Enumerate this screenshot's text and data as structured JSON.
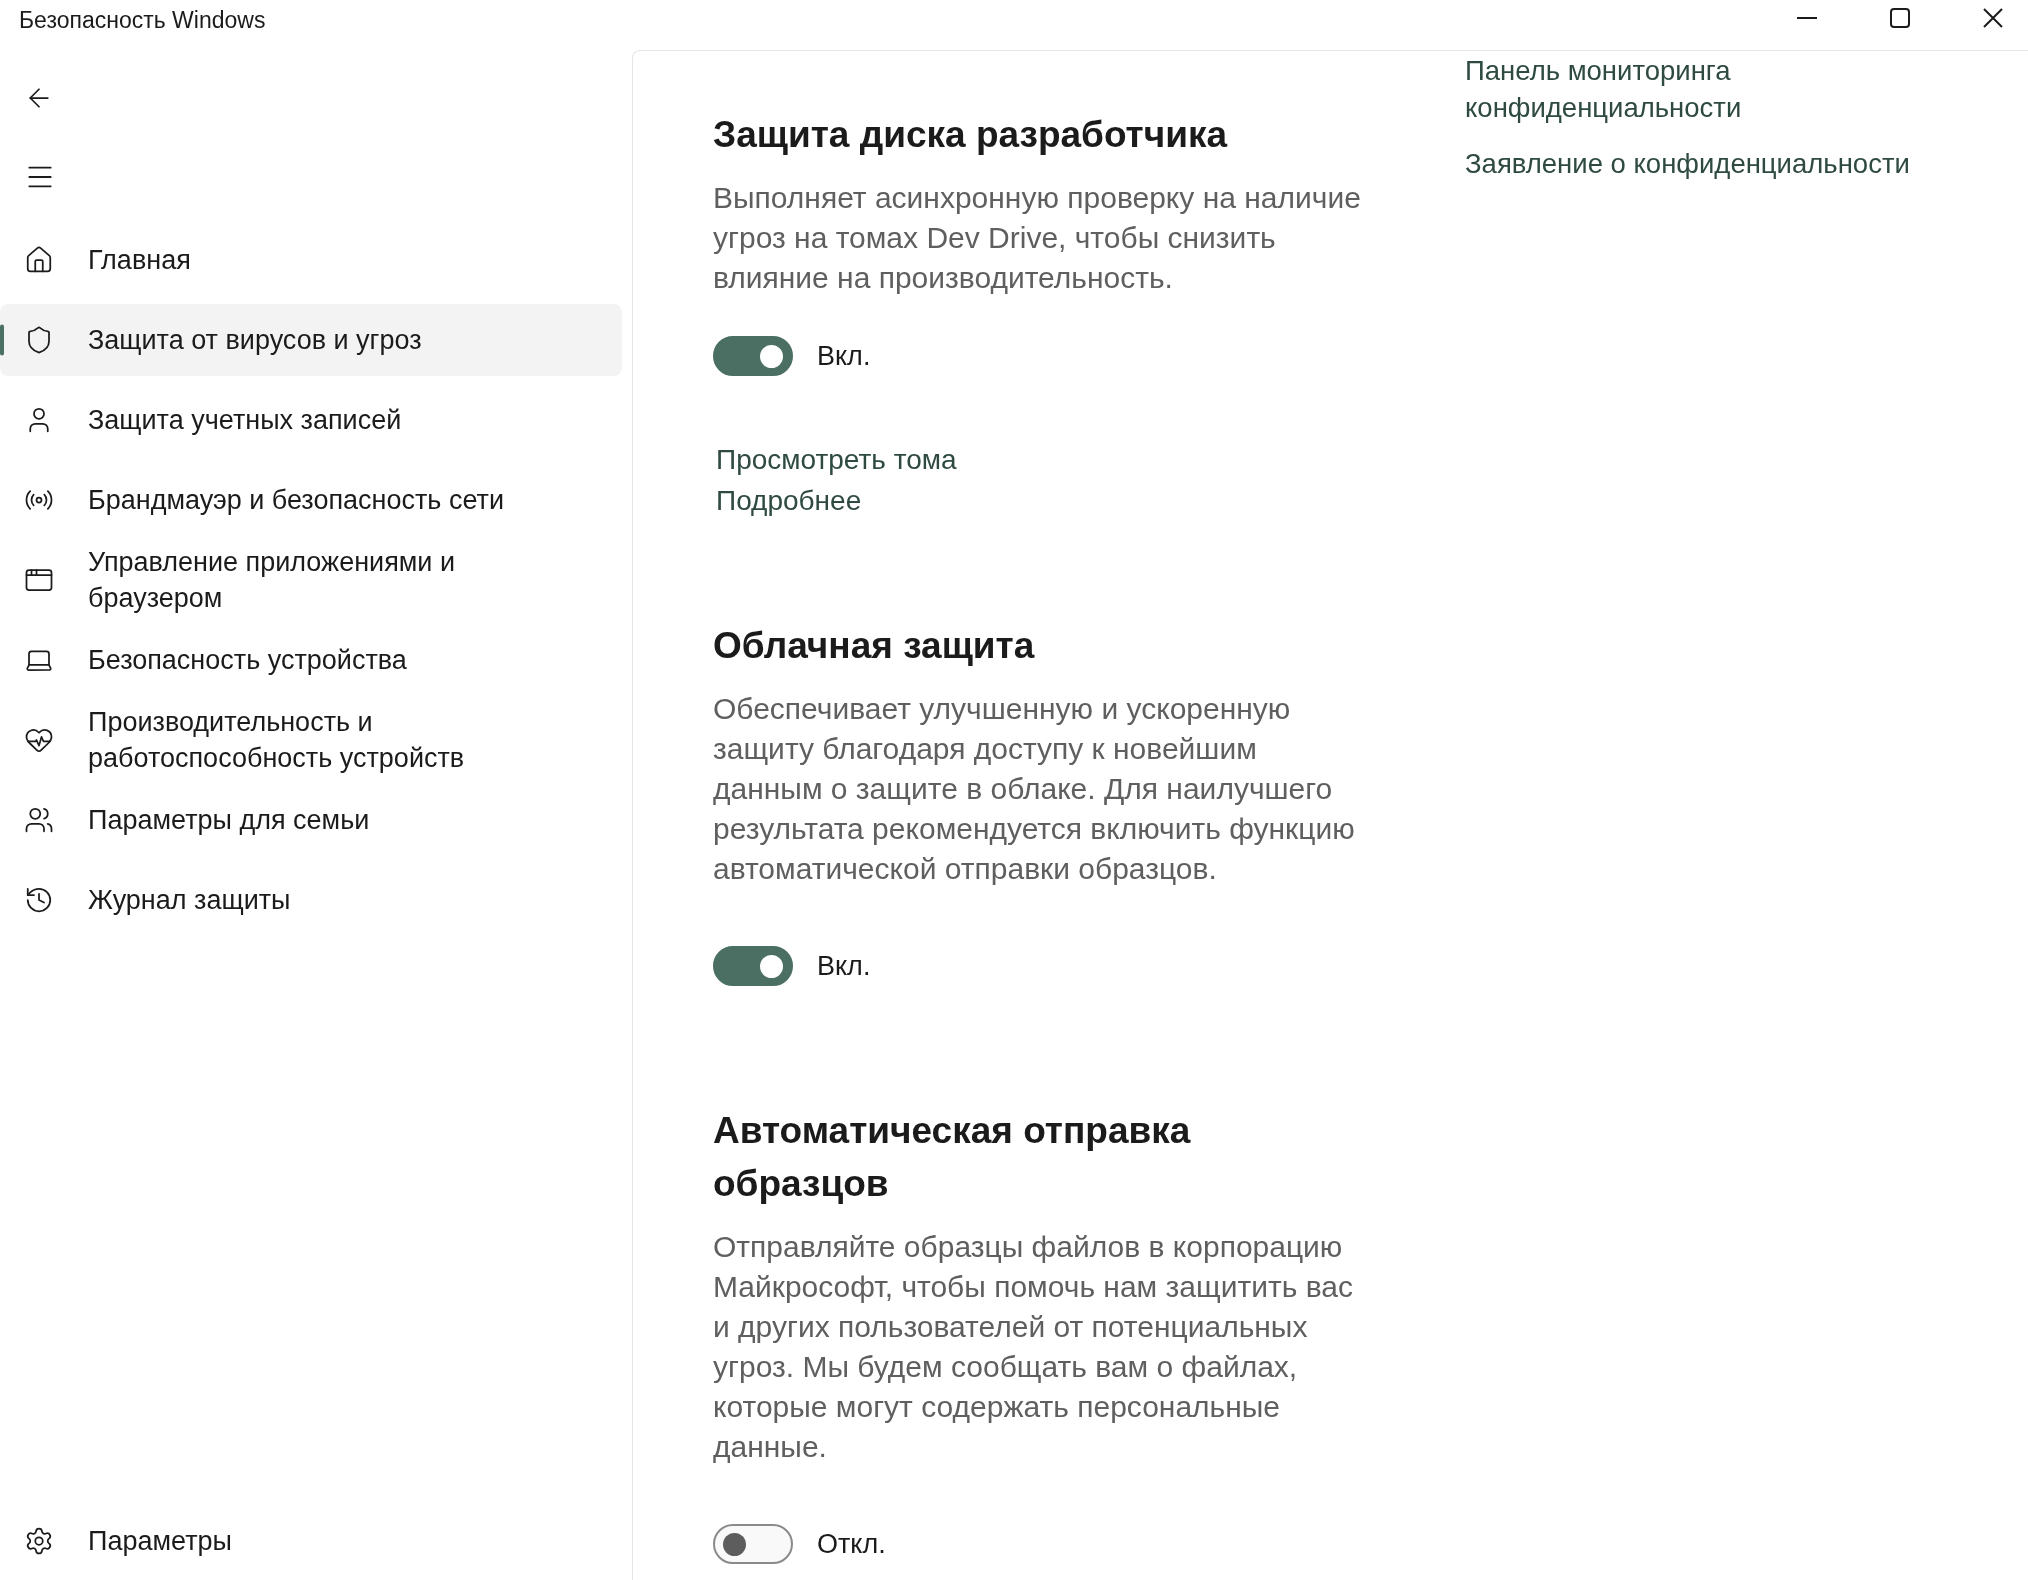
{
  "window": {
    "title": "Безопасность Windows"
  },
  "sidebar": {
    "items": [
      {
        "label": "Главная",
        "selected": false
      },
      {
        "label": "Защита от вирусов и угроз",
        "selected": true
      },
      {
        "label": "Защита учетных записей",
        "selected": false
      },
      {
        "label": "Брандмауэр и безопасность сети",
        "selected": false
      },
      {
        "label": "Управление приложениями и браузером",
        "selected": false
      },
      {
        "label": "Безопасность устройства",
        "selected": false
      },
      {
        "label": "Производительность и работоспособность устройств",
        "selected": false
      },
      {
        "label": "Параметры для семьи",
        "selected": false
      },
      {
        "label": "Журнал защиты",
        "selected": false
      }
    ],
    "footer": {
      "label": "Параметры"
    }
  },
  "sections": [
    {
      "title": "Защита диска разработчика",
      "description": "Выполняет асинхронную проверку на наличие угроз на томах Dev Drive, чтобы снизить влияние на производительность.",
      "toggle": {
        "on": true,
        "label": "Вкл."
      },
      "links": [
        "Просмотреть тома",
        "Подробнее"
      ]
    },
    {
      "title": "Облачная защита",
      "description": "Обеспечивает улучшенную и ускоренную защиту благодаря доступу к новейшим данным о защите в облаке. Для наилучшего результата рекомендуется включить функцию автоматической отправки образцов.",
      "toggle": {
        "on": true,
        "label": "Вкл."
      }
    },
    {
      "title": "Автоматическая отправка образцов",
      "description": "Отправляйте образцы файлов в корпорацию Майкрософт, чтобы помочь нам защитить вас и других пользователей от потенциальных угроз. Мы будем сообщать вам о файлах, которые могут содержать персональные данные.",
      "toggle": {
        "on": false,
        "label": "Откл."
      }
    }
  ],
  "side_links": [
    "Панель мониторинга конфиденциальности",
    "Заявление о конфиденциальности"
  ]
}
